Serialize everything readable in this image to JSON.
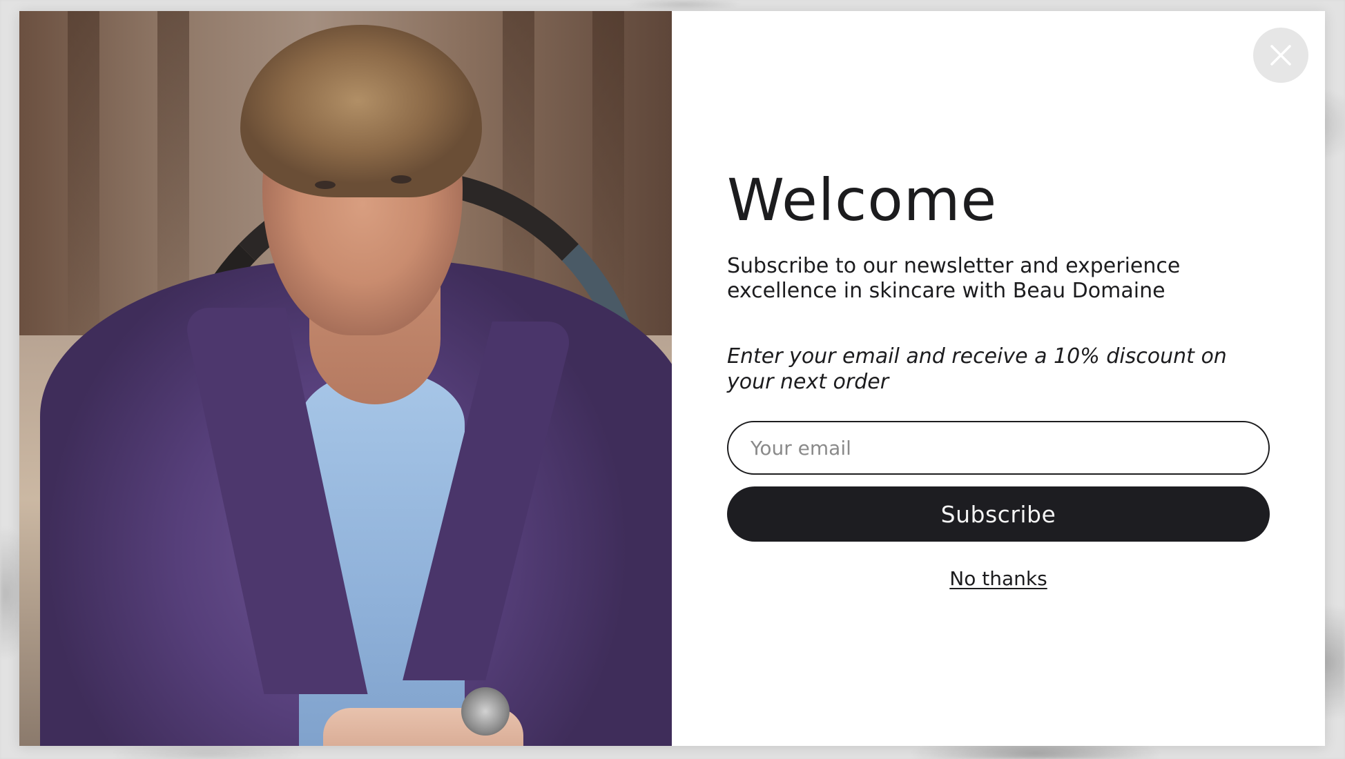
{
  "popup": {
    "title": "Welcome",
    "subtitle": "Subscribe to our newsletter and experience excellence in skincare with Beau Domaine",
    "offer_text": "Enter your email and receive a 10% discount on your next order",
    "email_placeholder": "Your email",
    "email_value": "",
    "subscribe_label": "Subscribe",
    "decline_label": "No thanks",
    "close_icon": "close-icon"
  },
  "colors": {
    "button_background": "#1d1d21",
    "button_text": "#f4f4f4",
    "text_primary": "#1c1c1e",
    "close_button_background": "#e6e6e6",
    "placeholder": "#8a8a8a"
  }
}
